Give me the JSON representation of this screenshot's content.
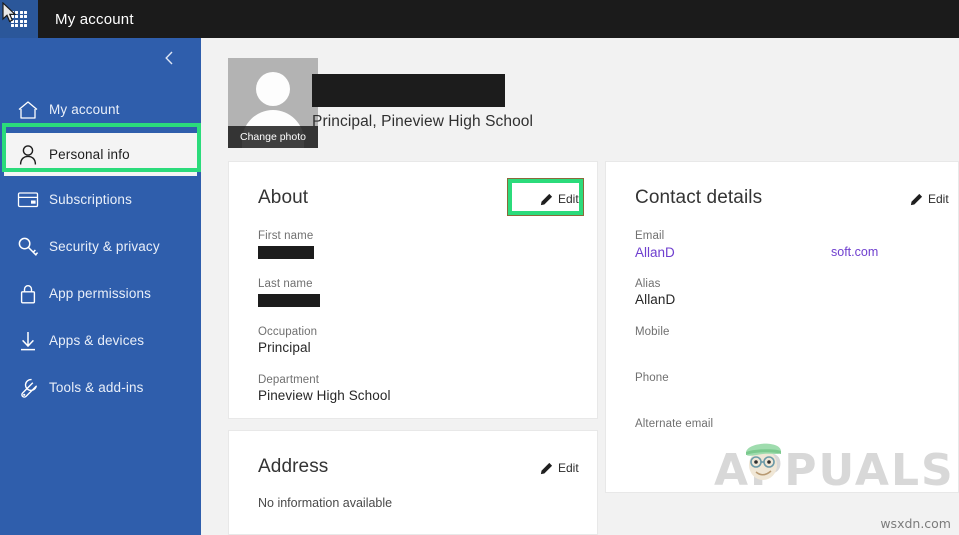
{
  "window": {
    "app_title": "My account",
    "waffle_icon": "app-launcher-waffle-icon",
    "cursor_icon": "mouse-pointer-icon"
  },
  "sidebar": {
    "collapse_icon": "chevron-left-icon",
    "items": [
      {
        "label": "My account",
        "icon": "home-icon",
        "selected": false
      },
      {
        "label": "Personal info",
        "icon": "person-icon",
        "selected": true
      },
      {
        "label": "Subscriptions",
        "icon": "card-icon",
        "selected": false
      },
      {
        "label": "Security & privacy",
        "icon": "key-icon",
        "selected": false
      },
      {
        "label": "App permissions",
        "icon": "lock-icon",
        "selected": false
      },
      {
        "label": "Apps & devices",
        "icon": "download-arrow-icon",
        "selected": false
      },
      {
        "label": "Tools & add-ins",
        "icon": "wrench-icon",
        "selected": false
      }
    ]
  },
  "profile": {
    "change_photo_label": "Change photo",
    "avatar_icon": "default-avatar-icon",
    "display_name": "",
    "role_line": "Principal, Pineview High School"
  },
  "about": {
    "title": "About",
    "edit_label": "Edit",
    "edit_icon": "pencil-icon",
    "fields": [
      {
        "label": "First name",
        "value": "",
        "redacted": true
      },
      {
        "label": "Last name",
        "value": "",
        "redacted": true
      },
      {
        "label": "Occupation",
        "value": "Principal",
        "redacted": false
      },
      {
        "label": "Department",
        "value": "Pineview High School",
        "redacted": false
      }
    ]
  },
  "address": {
    "title": "Address",
    "edit_label": "Edit",
    "edit_icon": "pencil-icon",
    "empty_text": "No information available"
  },
  "contact": {
    "title": "Contact details",
    "edit_label": "Edit",
    "edit_icon": "pencil-icon",
    "email_label": "Email",
    "email_left": "AllanD",
    "email_right": "soft.com",
    "alias_label": "Alias",
    "alias_value": "AllanD",
    "mobile_label": "Mobile",
    "mobile_value": "",
    "phone_label": "Phone",
    "phone_value": "",
    "alt_email_label": "Alternate email",
    "alt_email_value": ""
  },
  "watermark": {
    "brand": "APPUALS",
    "source": "wsxdn.com"
  },
  "colors": {
    "sidebar_blue": "#2f5eac",
    "waffle_blue": "#2b579a",
    "topbar_black": "#1b1b1b",
    "highlight_green": "#2bdb7b",
    "link_purple": "#6f3fcf",
    "page_bg": "#f2f2f2"
  }
}
